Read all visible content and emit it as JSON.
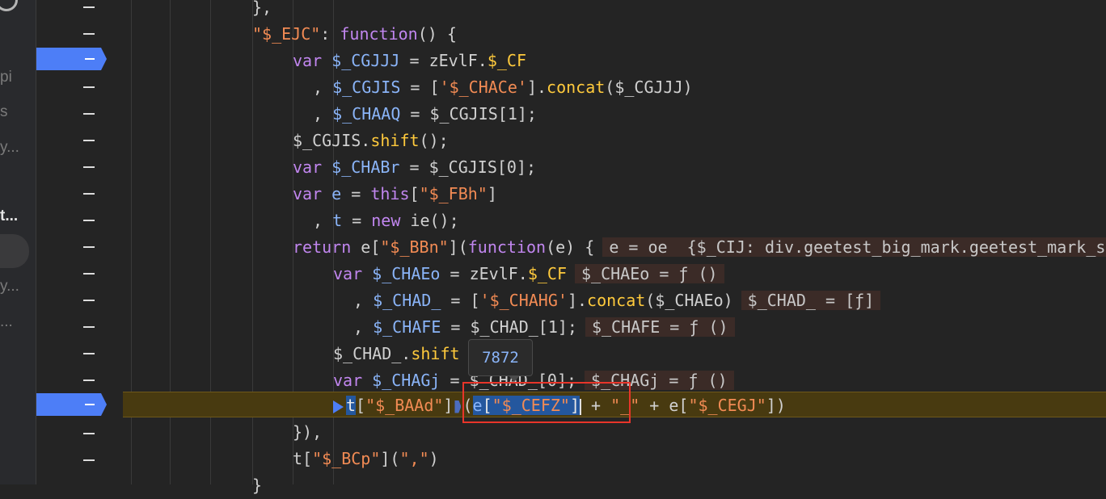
{
  "sidebar": {
    "items": [
      {
        "label": "pi"
      },
      {
        "label": "s"
      },
      {
        "label": "y..."
      },
      {
        "label": "t..."
      },
      {
        "label": "y..."
      },
      {
        "label": "..."
      }
    ]
  },
  "breakpoints": [
    {
      "line": "line-3",
      "active": true
    },
    {
      "line": "line-16",
      "active": true,
      "current": true
    }
  ],
  "code": {
    "l1": "},",
    "l2": {
      "key": "\"$_EJC\"",
      "colon": ": ",
      "fn": "function",
      "rest": "() {"
    },
    "l3": {
      "kw": "var ",
      "name": "$_CGJJJ",
      "eq": " = zEvlF.",
      "prop": "$_CF"
    },
    "l4": {
      "lead": ", ",
      "name": "$_CGJIS",
      "eq": " = [",
      "str": "'$_CHACe'",
      "close": "].",
      "method": "concat",
      "args": "($_CGJJJ)"
    },
    "l5": {
      "lead": ", ",
      "name": "$_CHAAQ",
      "rest": " = $_CGJIS[1];"
    },
    "l6": {
      "obj": "$_CGJIS.",
      "method": "shift",
      "rest": "();"
    },
    "l7": {
      "kw": "var ",
      "name": "$_CHABr",
      "rest": " = $_CGJIS[0];"
    },
    "l8": {
      "kw": "var ",
      "name": "e",
      "eq": " = ",
      "kw2": "this",
      "open": "[",
      "str": "\"$_FBh\"",
      "close": "]"
    },
    "l9": {
      "lead": ", ",
      "name": "t",
      "eq": " = ",
      "kw": "new",
      "rest": " ie();"
    },
    "l10": {
      "kw": "return",
      "obj": " e[",
      "str": "\"$_BBn\"",
      "mid": "](",
      "fn": "function",
      "rest": "(e) {",
      "inline": "e = oe  {$_CIJ: div.geetest_big_mark.geetest_mark_show"
    },
    "l11": {
      "kw": "var ",
      "name": "$_CHAEo",
      "eq": " = zEvlF.",
      "prop": "$_CF",
      "inline": "$_CHAEo = ƒ ()"
    },
    "l12": {
      "lead": ", ",
      "name": "$_CHAD_",
      "eq": " = [",
      "str": "'$_CHAHG'",
      "close": "].",
      "method": "concat",
      "args": "($_CHAEo)",
      "inline": "$_CHAD_ = [ƒ]"
    },
    "l13": {
      "lead": ", ",
      "name": "$_CHAFE",
      "rest": " = $_CHAD_[1];",
      "inline": "$_CHAFE = ƒ ()"
    },
    "l14": {
      "obj": "$_CHAD_.",
      "method": "shift"
    },
    "l15": {
      "kw": "var ",
      "name": "$_CHAGj",
      "rest": " = $_CHAD_[0];",
      "inline": "$_CHAGj = ƒ ()"
    },
    "l16": {
      "t": "t",
      "open": "[",
      "str1": "\"$_BAAd\"",
      "close1": "]",
      "paren": "(",
      "e": "e",
      "open2": "[",
      "str2": "\"$_CEFZ\"",
      "close2": "]",
      "plus1": " + ",
      "str3": "\"_\"",
      "plus2": " + e[",
      "str4": "\"$_CEGJ\"",
      "end": "])"
    },
    "l17": "}),",
    "l18": {
      "obj": "t[",
      "str": "\"$_BCp\"",
      "mid": "](",
      "str2": "\",\"",
      "end": ")"
    },
    "l19": "}"
  },
  "tooltip": {
    "value": "7872"
  }
}
